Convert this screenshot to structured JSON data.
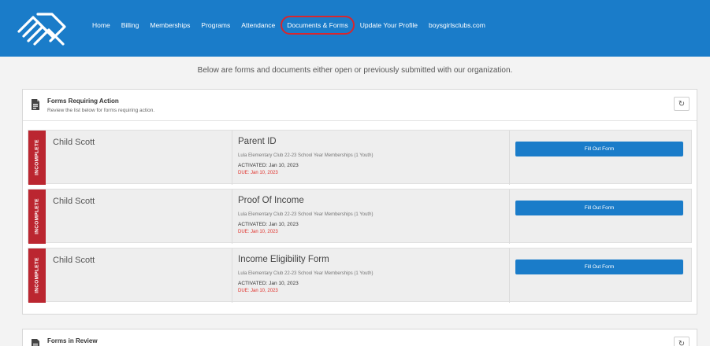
{
  "nav": {
    "items": [
      "Home",
      "Billing",
      "Memberships",
      "Programs",
      "Attendance",
      "Documents & Forms",
      "Update Your Profile",
      "boysgirlsclubs.com"
    ],
    "active_index": 5
  },
  "intro_text": "Below are forms and documents either open or previously submitted with our organization.",
  "requiring_action": {
    "title": "Forms Requiring Action",
    "subtitle": "Review the list below for forms requiring action.",
    "refresh_icon": "refresh-icon",
    "rows": [
      {
        "status": "INCOMPLETE",
        "child": "Child Scott",
        "form": "Parent ID",
        "program": "Lula Elementary Club 22-23 School Year Memberships (1 Youth)",
        "activated": "ACTIVATED: Jan 10, 2023",
        "due": "DUE: Jan 10, 2023",
        "button": "Fill Out Form"
      },
      {
        "status": "INCOMPLETE",
        "child": "Child Scott",
        "form": "Proof Of Income",
        "program": "Lula Elementary Club 22-23 School Year Memberships (1 Youth)",
        "activated": "ACTIVATED: Jan 10, 2023",
        "due": "DUE: Jan 10, 2023",
        "button": "Fill Out Form"
      },
      {
        "status": "INCOMPLETE",
        "child": "Child Scott",
        "form": "Income Eligibility Form",
        "program": "Lula Elementary Club 22-23 School Year Memberships (1 Youth)",
        "activated": "ACTIVATED: Jan 10, 2023",
        "due": "DUE: Jan 10, 2023",
        "button": "Fill Out Form"
      }
    ]
  },
  "in_review": {
    "title": "Forms in Review"
  },
  "colors": {
    "brand_blue": "#1a7cc9",
    "incomplete_red": "#bb2630",
    "due_red": "#e0302a",
    "highlight_circle": "#d8262d"
  }
}
